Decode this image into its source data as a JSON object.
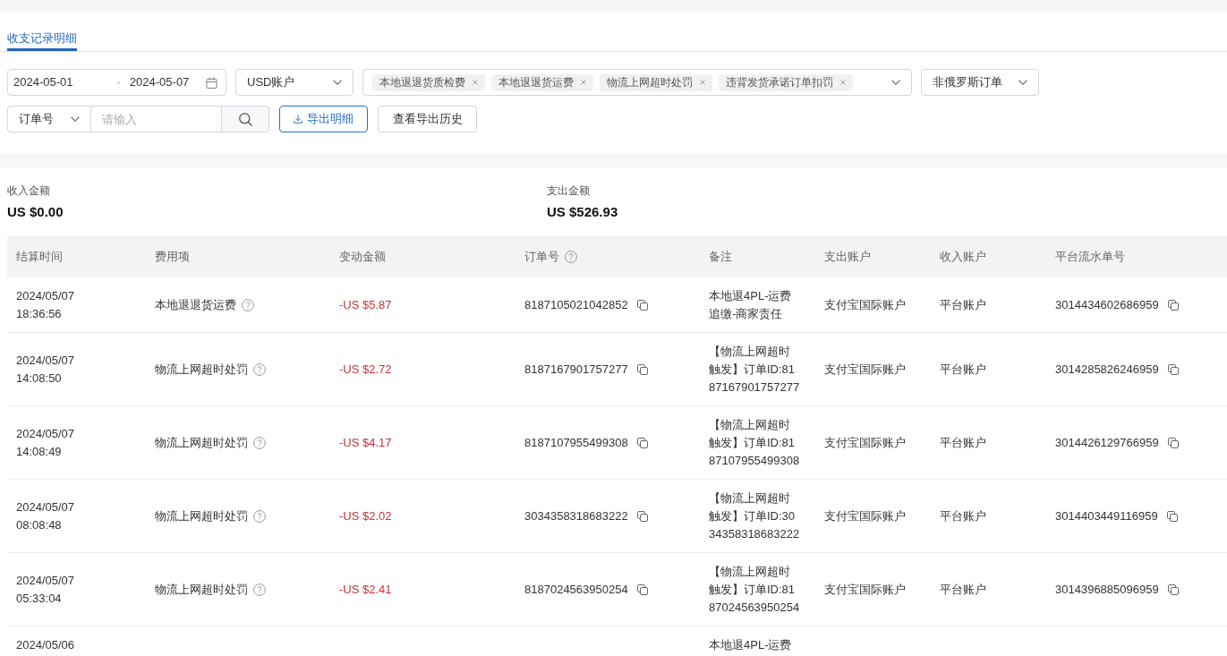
{
  "tabs": [
    {
      "label": "收支记录明细",
      "selected": true
    }
  ],
  "filters": {
    "date_range": {
      "start": "2024-05-01",
      "separator": "-",
      "end": "2024-05-07"
    },
    "account_select": {
      "value": "USD账户"
    },
    "fee_type_select": {
      "tags": [
        "本地退退货质检费",
        "本地退退货运费",
        "物流上网超时处罚",
        "违背发货承诺订单扣罚"
      ]
    },
    "order_type_select": {
      "value": "非俄罗斯订单"
    },
    "search": {
      "field": "订单号",
      "placeholder": "请输入"
    },
    "buttons": [
      {
        "label": "导出明细",
        "kind": "primary"
      },
      {
        "label": "查看导出历史",
        "kind": "default"
      }
    ]
  },
  "summary": [
    {
      "label": "收入金额",
      "value": "US $0.00"
    },
    {
      "label": "支出金额",
      "value": "US $526.93"
    }
  ],
  "table": {
    "columns": [
      {
        "label": "结算时间",
        "help": false
      },
      {
        "label": "费用项",
        "help": false
      },
      {
        "label": "变动金额",
        "help": false
      },
      {
        "label": "订单号",
        "help": true
      },
      {
        "label": "备注",
        "help": false
      },
      {
        "label": "支出账户",
        "help": false
      },
      {
        "label": "收入账户",
        "help": false
      },
      {
        "label": "平台流水单号",
        "help": false
      }
    ],
    "rows": [
      {
        "settled_at": "2024/05/07 18:36:56",
        "fee_item": "本地退退货运费",
        "amount": "-US $5.87",
        "order_no": "8187105021042852",
        "remark": "本地退4PL-运费追缴-商家责任",
        "payer_account": "支付宝国际账户",
        "payee_account": "平台账户",
        "serial_no": "3014434602686959"
      },
      {
        "settled_at": "2024/05/07 14:08:50",
        "fee_item": "物流上网超时处罚",
        "amount": "-US $2.72",
        "order_no": "8187167901757277",
        "remark": "【物流上网超时触发】订单ID:8187167901757277",
        "payer_account": "支付宝国际账户",
        "payee_account": "平台账户",
        "serial_no": "3014285826246959"
      },
      {
        "settled_at": "2024/05/07 14:08:49",
        "fee_item": "物流上网超时处罚",
        "amount": "-US $4.17",
        "order_no": "8187107955499308",
        "remark": "【物流上网超时触发】订单ID:8187107955499308",
        "payer_account": "支付宝国际账户",
        "payee_account": "平台账户",
        "serial_no": "3014426129766959"
      },
      {
        "settled_at": "2024/05/07 08:08:48",
        "fee_item": "物流上网超时处罚",
        "amount": "-US $2.02",
        "order_no": "3034358318683222",
        "remark": "【物流上网超时触发】订单ID:3034358318683222",
        "payer_account": "支付宝国际账户",
        "payee_account": "平台账户",
        "serial_no": "3014403449116959"
      },
      {
        "settled_at": "2024/05/07 05:33:04",
        "fee_item": "物流上网超时处罚",
        "amount": "-US $2.41",
        "order_no": "8187024563950254",
        "remark": "【物流上网超时触发】订单ID:8187024563950254",
        "payer_account": "支付宝国际账户",
        "payee_account": "平台账户",
        "serial_no": "3014396885096959"
      },
      {
        "settled_at": "2024/05/06",
        "remark": "本地退4PL-运费"
      }
    ]
  }
}
